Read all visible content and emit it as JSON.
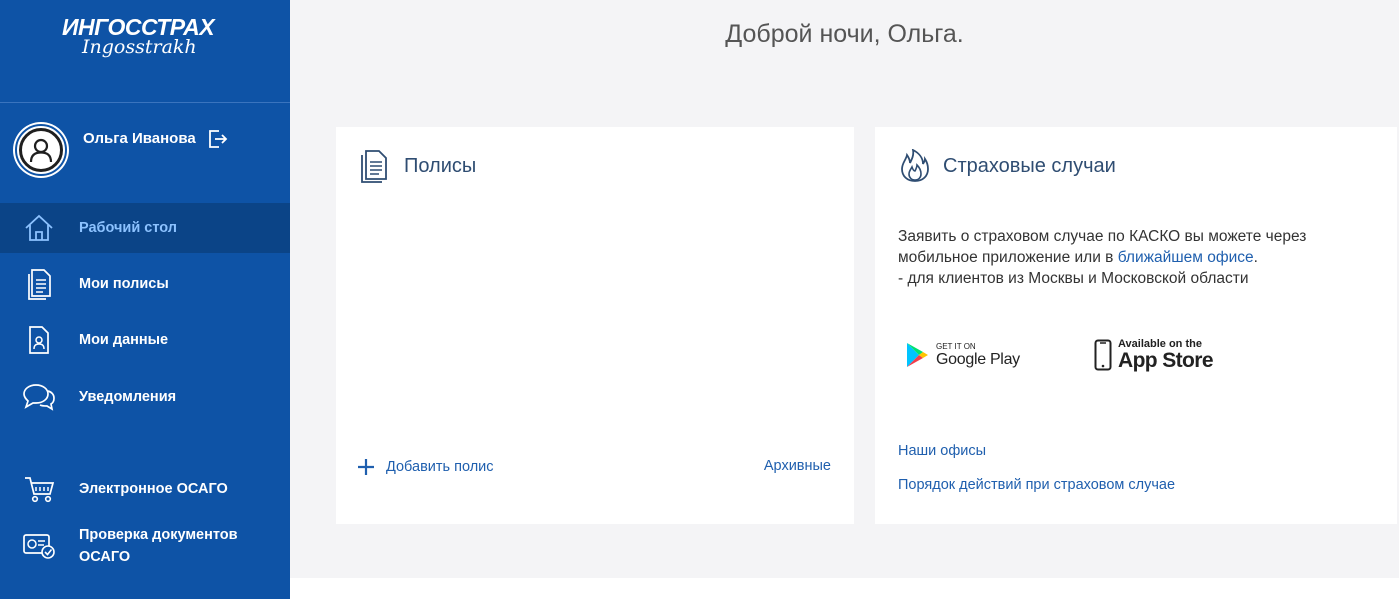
{
  "brand": {
    "main": "ИНГОССТРАХ",
    "sub": "Ingosstrakh"
  },
  "user": {
    "name": "Ольга Иванова"
  },
  "nav": {
    "desktop": "Рабочий стол",
    "my_policies": "Мои полисы",
    "my_data": "Мои данные",
    "notifications": "Уведомления",
    "osago": "Электронное ОСАГО",
    "check_docs": "Проверка документов ОСАГО"
  },
  "greeting": "Доброй ночи, Ольга.",
  "policies_card": {
    "title": "Полисы",
    "add_label": "Добавить полис",
    "archive_label": "Архивные"
  },
  "cases_card": {
    "title": "Страховые случаи",
    "text_part1": "Заявить о страховом случае по КАСКО вы можете через мобильное приложение или в ",
    "text_link": "ближайшем офисе",
    "text_part2": ".",
    "text_line3": "- для клиентов из Москвы и Московской области",
    "google_play": {
      "small": "GET IT ON",
      "big": "Google Play"
    },
    "app_store": {
      "small": "Available on the",
      "big": "App Store"
    },
    "offices_link": "Наши офисы",
    "procedure_link": "Порядок действий при страховом случае"
  },
  "colors": {
    "sidebar": "#0e53a6",
    "sidebar_active": "#0b4487",
    "active_label": "#8cc2ff",
    "link": "#1f5fae",
    "title": "#2f4d72",
    "background": "#f4f4f6"
  }
}
